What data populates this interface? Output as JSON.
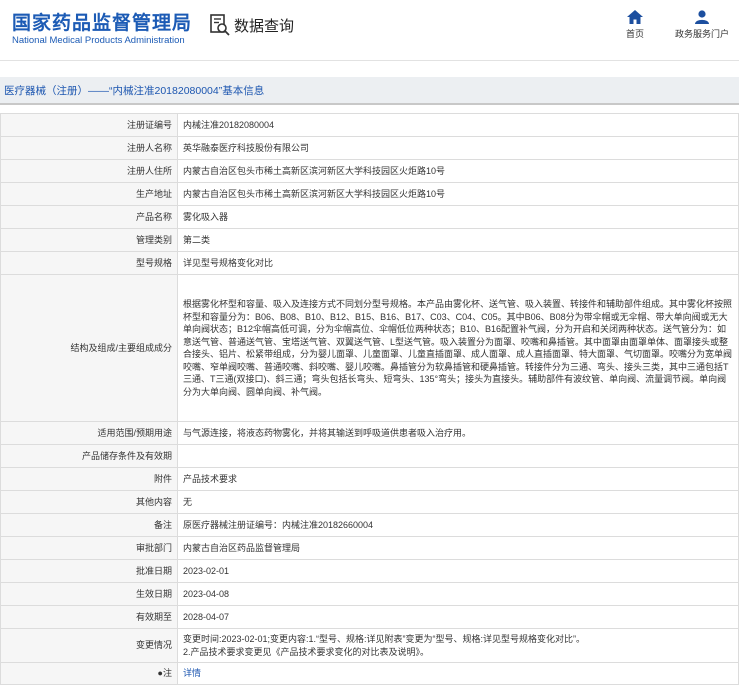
{
  "header": {
    "logo_cn": "国家药品监督管理局",
    "logo_en": "National Medical Products Administration",
    "title": "数据查询",
    "nav": [
      {
        "label": "首页",
        "icon": "home-icon"
      },
      {
        "label": "政务服务门户",
        "icon": "user-icon"
      }
    ]
  },
  "section_title": "医疗器械（注册）——“内械注准20182080004”基本信息",
  "rows": [
    {
      "label": "注册证编号",
      "value": "内械注准20182080004"
    },
    {
      "label": "注册人名称",
      "value": "英华融泰医疗科技股份有限公司"
    },
    {
      "label": "注册人住所",
      "value": "内蒙古自治区包头市稀土高新区滨河新区大学科技园区火炬路10号"
    },
    {
      "label": "生产地址",
      "value": "内蒙古自治区包头市稀土高新区滨河新区大学科技园区火炬路10号"
    },
    {
      "label": "产品名称",
      "value": "雾化吸入器"
    },
    {
      "label": "管理类别",
      "value": "第二类"
    },
    {
      "label": "型号规格",
      "value": "详见型号规格变化对比"
    },
    {
      "label": "结构及组成/主要组成成分",
      "value": "根据雾化杯型和容量、吸入及连接方式不同划分型号规格。本产品由雾化杯、送气管、吸入装置、转接件和辅助部件组成。其中雾化杯按照杯型和容量分为：B06、B08、B10、B12、B15、B16、B17、C03、C04、C05。其中B06、B08分为带伞帽或无伞帽、带大单向阀或无大单向阀状态；B12伞帽高低可调，分为伞帽高位、伞帽低位两种状态；B10、B16配置补气阀，分为开启和关闭两种状态。送气管分为：如意送气管、普通送气管、宝塔送气管、双翼送气管、L型送气管。吸入装置分为面罩、咬嘴和鼻插管。其中面罩由面罩单体、面罩接头或整合接头、铝片、松紧带组成，分为婴儿面罩、儿童面罩、儿童直插面罩、成人面罩、成人直插面罩、特大面罩、气切面罩。咬嘴分为宽单阀咬嘴、窄单阀咬嘴、普通咬嘴、斜咬嘴、婴儿咬嘴。鼻插管分为软鼻插管和硬鼻插管。转接件分为三通、弯头、接头三类，其中三通包括T三通、T三通(双接口)、斜三通；弯头包括长弯头、短弯头、135°弯头；接头为直接头。辅助部件有波纹管、单向阀、流量调节阀。单向阀分为大单向阀、圆单向阀、补气阀。"
    },
    {
      "label": "适用范围/预期用途",
      "value": "与气源连接，将液态药物雾化，并将其输送到呼吸道供患者吸入治疗用。"
    },
    {
      "label": "产品储存条件及有效期",
      "value": ""
    },
    {
      "label": "附件",
      "value": "产品技术要求"
    },
    {
      "label": "其他内容",
      "value": "无"
    },
    {
      "label": "备注",
      "value": "原医疗器械注册证编号：内械注准20182660004"
    },
    {
      "label": "审批部门",
      "value": "内蒙古自治区药品监督管理局"
    },
    {
      "label": "批准日期",
      "value": "2023-02-01"
    },
    {
      "label": "生效日期",
      "value": "2023-04-08"
    },
    {
      "label": "有效期至",
      "value": "2028-04-07"
    },
    {
      "label": "变更情况",
      "value": "变更时间:2023-02-01;变更内容:1.“型号、规格:详见附表”变更为“型号、规格:详见型号规格变化对比”。\n2.产品技术要求变更见《产品技术要求变化的对比表及说明》。"
    },
    {
      "label": "注",
      "value": "详情"
    }
  ]
}
